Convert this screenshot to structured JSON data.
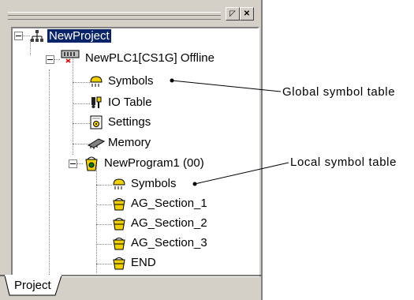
{
  "tree": {
    "project": "NewProject",
    "plc": "NewPLC1[CS1G] Offline",
    "plc_children": [
      "Symbols",
      "IO Table",
      "Settings",
      "Memory"
    ],
    "program": "NewProgram1 (00)",
    "program_children": [
      "Symbols",
      "AG_Section_1",
      "AG_Section_2",
      "AG_Section_3",
      "END"
    ]
  },
  "tabs": {
    "project": "Project"
  },
  "callouts": {
    "global": "Global symbol table",
    "local": "Local symbol table"
  }
}
